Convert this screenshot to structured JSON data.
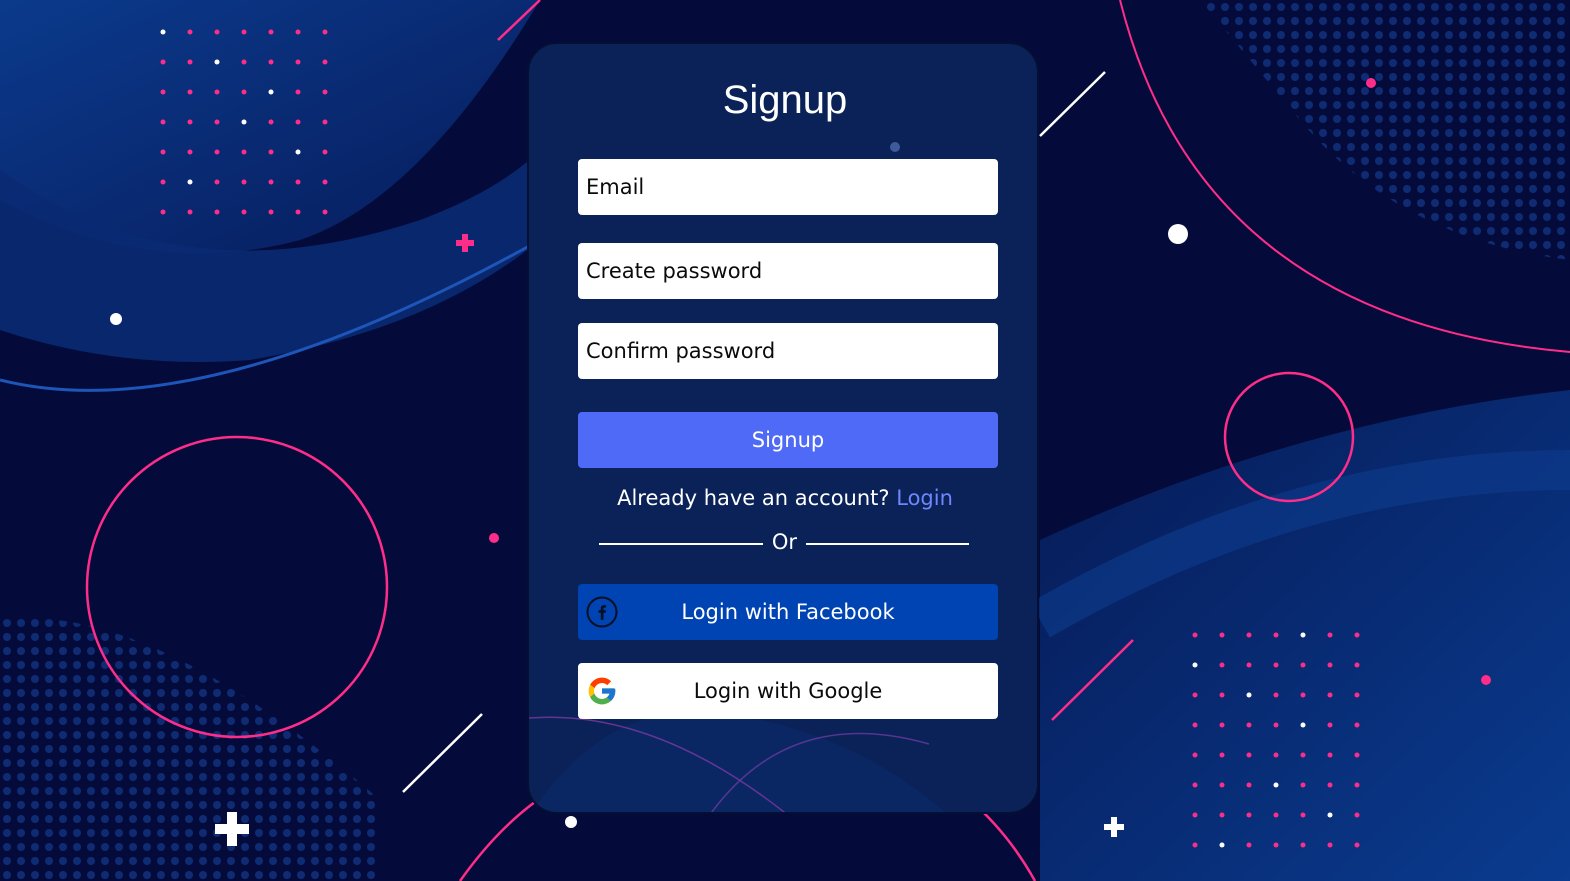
{
  "form": {
    "title": "Signup",
    "email_placeholder": "Email",
    "password_placeholder": "Create password",
    "confirm_placeholder": "Confirm password",
    "signup_button": "Signup",
    "already_text": "Already have an account?",
    "login_link": "Login",
    "divider_text": "Or",
    "facebook_button": "Login with Facebook",
    "google_button": "Login with Google"
  },
  "icons": {
    "facebook": "facebook-icon",
    "google": "google-icon"
  },
  "colors": {
    "background": "#040b3a",
    "card": "#0a2257",
    "signup_button": "#4f6af6",
    "facebook_button": "#0044b3",
    "link": "#6f86ff",
    "accent_pink": "#ff2d8a"
  }
}
